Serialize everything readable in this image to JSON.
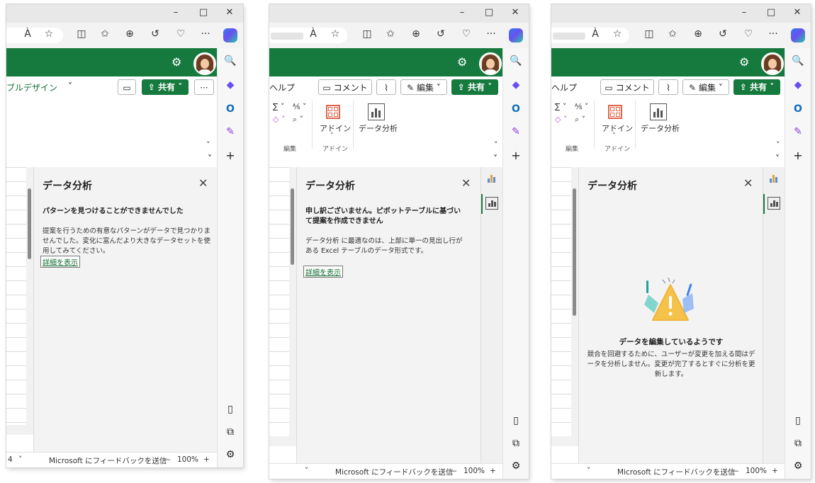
{
  "window_controls": {
    "minimize": "–",
    "maximize": "□",
    "close": "✕"
  },
  "toolbar_icons": [
    "read-aloud-icon",
    "favorite-star-icon",
    "split-screen-icon",
    "favorites-icon",
    "collections-icon",
    "history-icon",
    "performance-icon",
    "more-icon",
    "copilot-icon"
  ],
  "toolbar_glyphs": {
    "read_aloud": "À",
    "star": "☆",
    "split": "◫",
    "favorites": "✩",
    "collections": "⊕",
    "history": "↺",
    "perf": "♡",
    "more": "···"
  },
  "sidebar_glyphs": {
    "search": "🔍",
    "m365": "◆",
    "outlook": "O",
    "designer": "✎",
    "add": "+",
    "layout": "▯",
    "open_new": "⧉",
    "settings": "⚙"
  },
  "app_header": {
    "gear_glyph": "⚙"
  },
  "ribbon": {
    "tab_table_design": "ブルデザイン",
    "tab_help": "ヘルプ",
    "comment_button": "コメント",
    "edit_button": "編集",
    "share_button": "共有",
    "more_button": "···",
    "group_edit": "編集",
    "group_addin": "アドイン",
    "addin_label": "アドイン",
    "data_analysis_label": "データ分析",
    "sum_glyph": "∑ ˅",
    "sort_glyph": "⅍ ˅",
    "clear_glyph": "◇ ˅",
    "find_glyph": "⌕ ˅",
    "chevron": "˅"
  },
  "panel": {
    "title": "データ分析",
    "close_glyph": "✕"
  },
  "window1_panel": {
    "heading": "パターンを見つけることができませんでした",
    "body": "提案を行うための有意なパターンがデータで見つかりませんでした。変化に富んだより大きなデータセットを使用してみてください。",
    "link": "詳細を表示"
  },
  "window2_panel": {
    "heading": "申し訳ございません。ピボットテーブルに基づいて提案を作成できません",
    "body": "データ分析 に最適なのは、上部に単一の見出し行がある Excel テーブルのデータ形式です。",
    "link": "詳細を表示"
  },
  "window3_panel": {
    "heading": "データを編集しているようです",
    "body": "競合を回避するために、ユーザーが変更を加える間はデータを分析しません。変更が完了するとすぐに分析を更新します。"
  },
  "status": {
    "feedback": "Microsoft にフィードバックを送信",
    "zoom": "100%",
    "zoom_out": "—",
    "zoom_in": "+",
    "page_fragment": "4",
    "chevron": "˅"
  },
  "colors": {
    "excel_green": "#167a3e",
    "link_green": "#0e6b32",
    "warning_yellow": "#f5c24a",
    "accent_blue": "#3b82f6",
    "accent_teal": "#21a39b"
  }
}
